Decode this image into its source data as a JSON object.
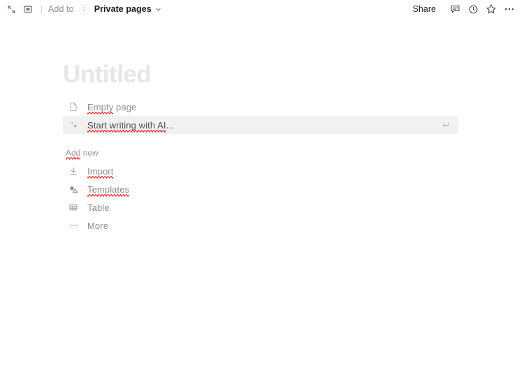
{
  "topbar": {
    "left_icons": [
      {
        "name": "collapse-expand-icon",
        "title": "Expand"
      },
      {
        "name": "window-icon",
        "title": "Window"
      }
    ],
    "add_to_label": "Add to",
    "avatar_initial": "J",
    "location_name": "Private pages",
    "share_label": "Share",
    "right_icons": [
      {
        "name": "comment-icon",
        "title": "Comments"
      },
      {
        "name": "history-icon",
        "title": "Page history"
      },
      {
        "name": "star-icon",
        "title": "Favorite"
      },
      {
        "name": "more-icon",
        "title": "More options"
      }
    ]
  },
  "page": {
    "title_placeholder": "Untitled",
    "primary_options": [
      {
        "icon": "page-icon",
        "label": "Empty page",
        "selected": false,
        "misspelled": "Empty",
        "rest": " page",
        "shortcut": ""
      },
      {
        "icon": "ai-sparkle-icon",
        "label": "Start writing with AI...",
        "selected": true,
        "misspelled": "Start writing with AI",
        "rest": "...",
        "shortcut": "enter-key-icon"
      }
    ],
    "add_new_label": "Add new",
    "add_new_options": [
      {
        "icon": "import-icon",
        "label": "Import",
        "misspelled": "Import",
        "rest": ""
      },
      {
        "icon": "templates-icon",
        "label": "Templates",
        "misspelled": "Templates",
        "rest": ""
      },
      {
        "icon": "table-icon",
        "label": "Table",
        "misspelled": "",
        "rest": "Table"
      },
      {
        "icon": "more-dots-icon",
        "label": "More",
        "misspelled": "",
        "rest": "More"
      }
    ]
  },
  "colors": {
    "accent_purple": "#9b6fc4",
    "spellcheck_red": "#e8262c",
    "selected_row_bg": "#f1f1f1",
    "title_placeholder": "#e6e6e6"
  }
}
